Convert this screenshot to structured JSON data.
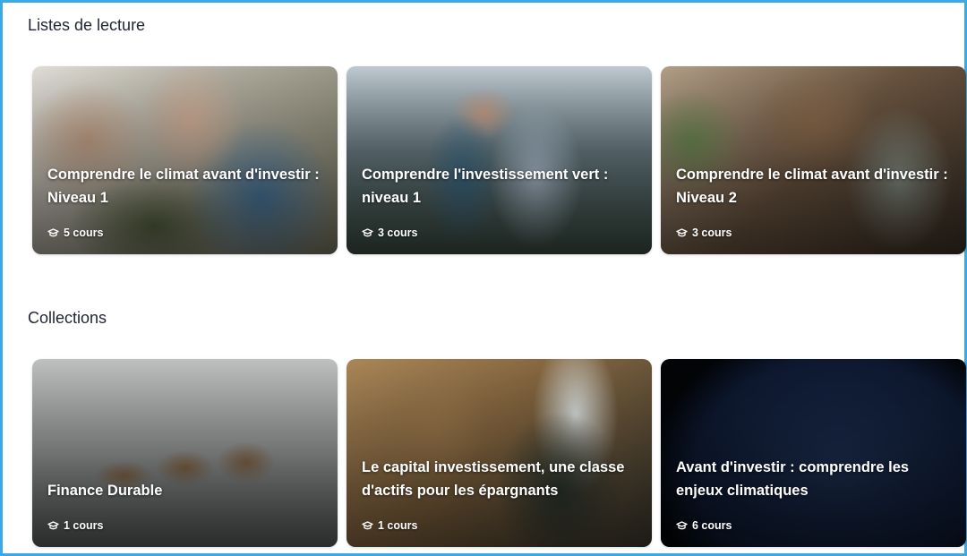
{
  "sections": {
    "playlists": {
      "title": "Listes de lecture",
      "cards": [
        {
          "title": "Comprendre le climat avant d'investir : Niveau 1",
          "count": "5 cours",
          "image": "family-smartphone-photo"
        },
        {
          "title": "Comprendre l'investissement vert : niveau 1",
          "count": "3 cours",
          "image": "coworkers-tablet-photo"
        },
        {
          "title": "Comprendre le climat avant d'investir : Niveau 2",
          "count": "3 cours",
          "image": "man-coffee-phone-photo"
        }
      ]
    },
    "collections": {
      "title": "Collections",
      "cards": [
        {
          "title": "Finance Durable",
          "count": "1 cours",
          "image": "coins-plants-growth-photo"
        },
        {
          "title": "Le capital investissement, une classe d'actifs pour les épargnants",
          "count": "1 cours",
          "image": "team-meeting-photo"
        },
        {
          "title": "Avant d'investir : comprendre les enjeux climatiques",
          "count": "6 cours",
          "image": "earth-night-lights-photo"
        }
      ]
    }
  },
  "icons": {
    "course_count": "graduation-cap-icon"
  },
  "colors": {
    "frame_border": "#3aa9e6",
    "heading": "#1f2533",
    "card_text": "#ffffff"
  }
}
